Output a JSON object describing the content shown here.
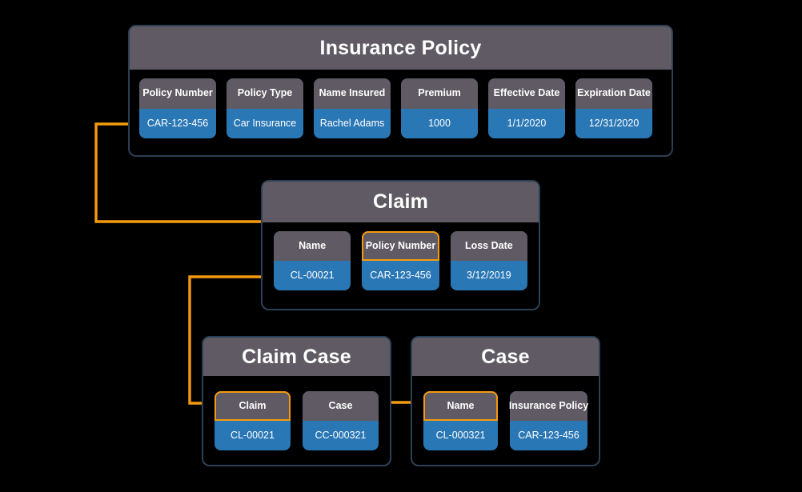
{
  "diagram": {
    "background": "#000000",
    "accent_highlight": "#f59a0e",
    "value_fill": "#2a77b5",
    "header_fill": "#5f5a63",
    "container_border": "#2c4055"
  },
  "entities": [
    {
      "id": "policy",
      "title": "Insurance Policy",
      "fields": [
        {
          "label": "Policy Number",
          "value": "CAR-123-456",
          "highlighted": false
        },
        {
          "label": "Policy Type",
          "value": "Car Insurance",
          "highlighted": false
        },
        {
          "label": "Name Insured",
          "value": "Rachel Adams",
          "highlighted": false
        },
        {
          "label": "Premium",
          "value": "1000",
          "highlighted": false
        },
        {
          "label": "Effective Date",
          "value": "1/1/2020",
          "highlighted": false
        },
        {
          "label": "Expiration Date",
          "value": "12/31/2020",
          "highlighted": false
        }
      ]
    },
    {
      "id": "claim",
      "title": "Claim",
      "fields": [
        {
          "label": "Name",
          "value": "CL-00021",
          "highlighted": false
        },
        {
          "label": "Policy Number",
          "value": "CAR-123-456",
          "highlighted": true
        },
        {
          "label": "Loss Date",
          "value": "3/12/2019",
          "highlighted": false
        }
      ]
    },
    {
      "id": "claimcase",
      "title": "Claim Case",
      "fields": [
        {
          "label": "Claim",
          "value": "CL-00021",
          "highlighted": true
        },
        {
          "label": "Case",
          "value": "CC-000321",
          "highlighted": false
        }
      ]
    },
    {
      "id": "case",
      "title": "Case",
      "fields": [
        {
          "label": "Name",
          "value": "CL-000321",
          "highlighted": true
        },
        {
          "label": "Insurance Policy",
          "value": "CAR-123-456",
          "highlighted": false
        }
      ]
    }
  ],
  "relationships": [
    {
      "name": "policy-number-to-claim-policy-number",
      "from": "Insurance Policy.Policy Number",
      "to": "Claim.Policy Number",
      "color": "#f59a0e"
    },
    {
      "name": "claim-name-to-claimcase-claim",
      "from": "Claim.Name",
      "to": "Claim Case.Claim",
      "color": "#f59a0e"
    },
    {
      "name": "claimcase-case-to-case-name",
      "from": "Claim Case.Case",
      "to": "Case.Name",
      "color": "#f59a0e"
    }
  ]
}
